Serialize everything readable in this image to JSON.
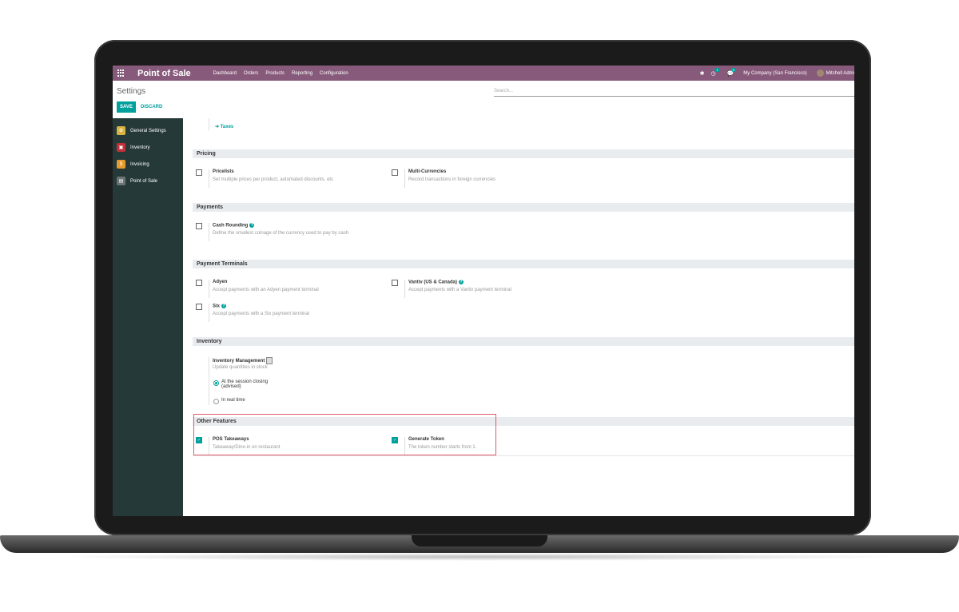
{
  "navbar": {
    "brand": "Point of Sale",
    "menu": [
      "Dashboard",
      "Orders",
      "Products",
      "Reporting",
      "Configuration"
    ],
    "activity_count": "1",
    "message_count": "6",
    "company": "My Company (San Francisco)",
    "user": "Mitchell Admi"
  },
  "control_panel": {
    "title": "Settings",
    "save_label": "SAVE",
    "discard_label": "DISCARD",
    "search_placeholder": "Search..."
  },
  "sidebar": {
    "items": [
      {
        "label": "General Settings",
        "icon": "gear-icon",
        "color": "#d9b341"
      },
      {
        "label": "Inventory",
        "icon": "box-icon",
        "color": "#c2303a"
      },
      {
        "label": "Invoicing",
        "icon": "invoice-icon",
        "color": "#e79a2d"
      },
      {
        "label": "Point of Sale",
        "icon": "pos-icon",
        "color": "#505a5a"
      }
    ]
  },
  "content": {
    "taxes_link": "Taxes",
    "pricing": {
      "title": "Pricing",
      "pricelists": {
        "label": "Pricelists",
        "desc": "Set multiple prices per product, automated discounts, etc",
        "checked": false
      },
      "multi_currencies": {
        "label": "Multi-Currencies",
        "desc": "Record transactions in foreign currencies",
        "checked": false
      }
    },
    "payments": {
      "title": "Payments",
      "cash_rounding": {
        "label": "Cash Rounding",
        "desc": "Define the smallest coinage of the currency used to pay by cash",
        "checked": false
      }
    },
    "payment_terminals": {
      "title": "Payment Terminals",
      "adyen": {
        "label": "Adyen",
        "desc": "Accept payments with an Adyen payment terminal",
        "checked": false
      },
      "vantiv": {
        "label": "Vantiv (US & Canada)",
        "desc": "Accept payments with a Vantiv payment terminal",
        "checked": false
      },
      "six": {
        "label": "Six",
        "desc": "Accept payments with a Six payment terminal",
        "checked": false
      }
    },
    "inventory": {
      "title": "Inventory",
      "label": "Inventory Management",
      "desc": "Update quantities in stock",
      "option_closing_line1": "At the session closing",
      "option_closing_line2": "(advised)",
      "option_realtime": "In real time"
    },
    "other_features": {
      "title": "Other Features",
      "pos_takeaways": {
        "label": "POS Takeaways",
        "desc": "Takeaway/Dine-in on restaurant",
        "checked": true
      },
      "generate_token": {
        "label": "Generate Token",
        "desc": "The token number starts from 1.",
        "checked": true
      }
    }
  },
  "colors": {
    "navbar": "#875a7b",
    "accent": "#00a09d",
    "sidebar": "#263939",
    "highlight": "#e05a6a"
  }
}
